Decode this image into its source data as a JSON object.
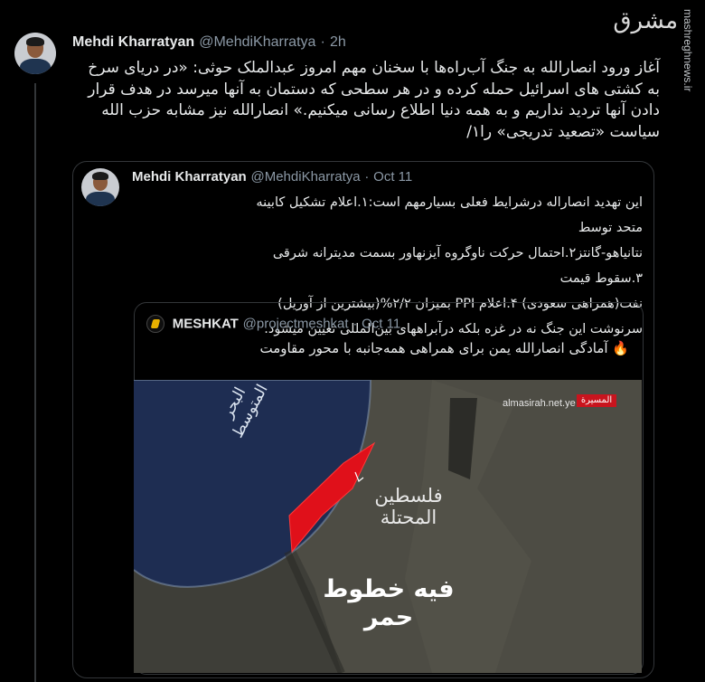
{
  "tweet": {
    "author_name": "Mehdi Kharratyan",
    "handle": "@MehdiKharratya",
    "separator": "·",
    "time": "2h",
    "text": "آغاز ورود انصارالله به جنگ آب‌راه‌ها با سخنان مهم امروز عبدالملک حوثی: «در دریای سرخ به کشتی های اسرائیل حمله کرده و در هر سطحی که دستمان به آنها میرسد در هدف قرار دادن آنها تردید نداریم و به همه دنیا اطلاع رسانی میکنیم.» انصارالله نیز مشابه حزب الله سیاست «تصعید تدریجی» را۱/"
  },
  "quoted_tweet": {
    "author_name": "Mehdi Kharratyan",
    "handle": "@MehdiKharratya",
    "separator": "·",
    "date": "Oct 11",
    "lines": [
      "این تهدید انصاراله درشرایط فعلی بسیارمهم است:۱.اعلام تشکیل کابینه متحد توسط",
      "نتانیاهو-گانتز۲.احتمال حرکت ناوگروه آیزنهاور بسمت مدیترانه شرقی ۳.سقوط قیمت",
      "نفت(همراهی سعودی) ۴.اعلام PPI بمیزان ۲/۲%(بیشترین از آوریل)",
      "سرنوشت این جنگ نه در غزه بلکه درآبراههای بین‌المللی تعیین میشود."
    ]
  },
  "nested_quote": {
    "author_name": "MESHKAT",
    "handle": "@projectmeshkat",
    "separator": "·",
    "date": "Oct 11",
    "text": "🔥 آمادگی انصارالله یمن برای همراهی همه‌جانبه با محور مقاومت"
  },
  "media": {
    "site": "almasirah.net.ye",
    "channel_label": "المسيرة",
    "sea_label": "البحر المتوسط",
    "region_label_1": "فلسطين",
    "region_label_2": "المحتلة",
    "caption": "فيه خطوط حمر",
    "colors": {
      "sea": "#1e2d52",
      "red_zone": "#e0101a",
      "land": "#4a4a42"
    }
  },
  "watermark": {
    "logo_text": "مشرق",
    "site": "mashreghnews.ir"
  },
  "colors": {
    "background": "#000000",
    "text": "#e7e9ea",
    "muted": "#8b98a5",
    "border": "#333639"
  }
}
